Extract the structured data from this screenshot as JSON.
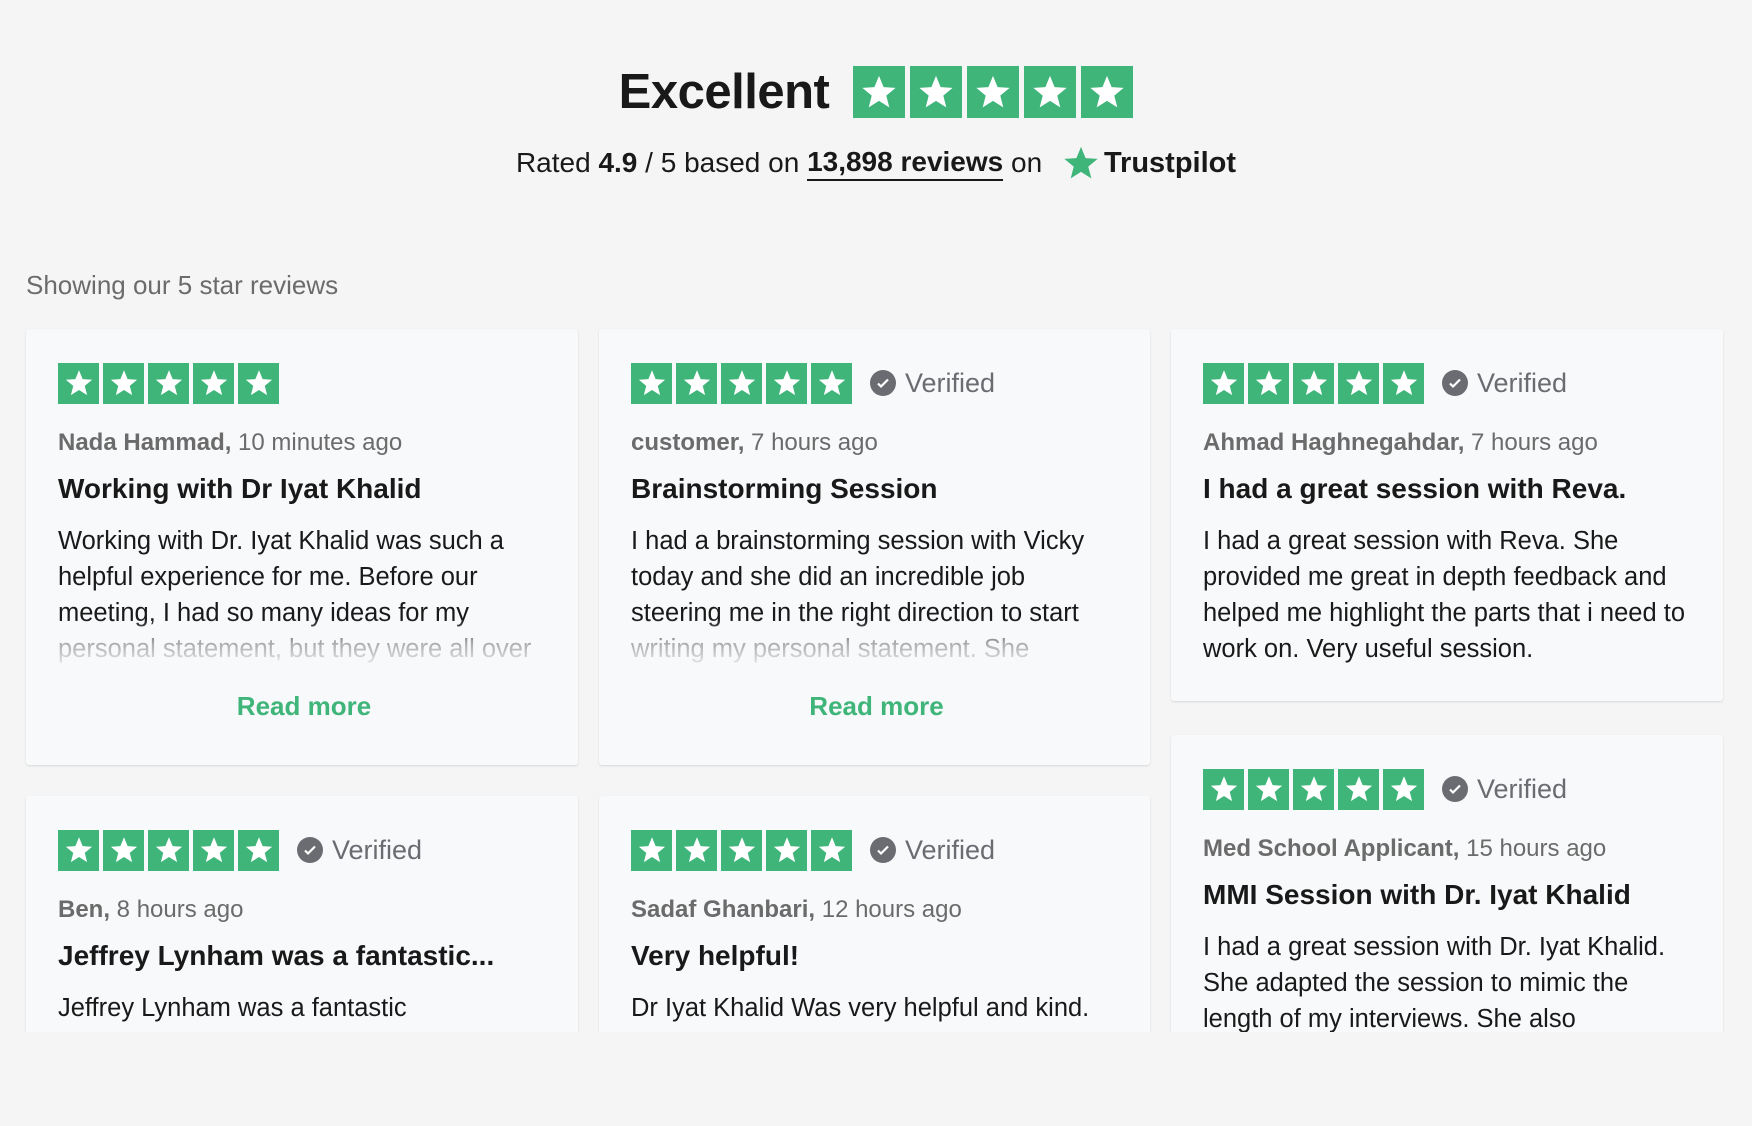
{
  "header": {
    "title": "Excellent",
    "rated_prefix": "Rated ",
    "rating": "4.9",
    "rating_suffix": " / 5 based on ",
    "reviews_link": "13,898 reviews",
    "on_text": " on ",
    "brand": "Trustpilot",
    "stars": 5
  },
  "colors": {
    "star_green": "#3fb57a",
    "verified_gray": "#6b6b72",
    "background": "#f5f5f5",
    "card": "#f8f9fa"
  },
  "showing_label": "Showing our 5 star reviews",
  "reviews": [
    {
      "stars": 5,
      "verified": false,
      "verified_label": "",
      "author": "Nada Hammad,",
      "time": " 10 minutes ago",
      "title": "Working with Dr Iyat Khalid",
      "body": "Working with Dr. Iyat Khalid was such a helpful experience for me. Before our meeting, I had so many ideas for my personal statement, but they were all over",
      "read_more": "Read more"
    },
    {
      "stars": 5,
      "verified": true,
      "verified_label": "Verified",
      "author": "customer,",
      "time": " 7 hours ago",
      "title": "Brainstorming Session",
      "body": "I had a brainstorming session with Vicky today and she did an incredible job steering me in the right direction to start writing my personal statement. She",
      "read_more": "Read more"
    },
    {
      "stars": 5,
      "verified": true,
      "verified_label": "Verified",
      "author": "Ahmad Haghnegahdar,",
      "time": " 7 hours ago",
      "title": "I had a great session with Reva.",
      "body": "I had a great session with Reva. She provided me great in depth feedback and helped me highlight the parts that i need to work on. Very useful session.",
      "read_more": ""
    },
    {
      "stars": 5,
      "verified": true,
      "verified_label": "Verified",
      "author": "Ben,",
      "time": " 8 hours ago",
      "title": "Jeffrey Lynham was a fantastic...",
      "body": "Jeffrey Lynham was a fantastic",
      "read_more": ""
    },
    {
      "stars": 5,
      "verified": true,
      "verified_label": "Verified",
      "author": "Sadaf Ghanbari,",
      "time": " 12 hours ago",
      "title": "Very helpful!",
      "body": "Dr Iyat Khalid Was very helpful and kind.",
      "read_more": ""
    },
    {
      "stars": 5,
      "verified": true,
      "verified_label": "Verified",
      "author": "Med School Applicant,",
      "time": " 15 hours ago",
      "title": "MMI Session with Dr. Iyat Khalid",
      "body": "I had a great session with Dr. Iyat Khalid. She adapted the session to mimic the length of my interviews. She also",
      "read_more": ""
    }
  ]
}
